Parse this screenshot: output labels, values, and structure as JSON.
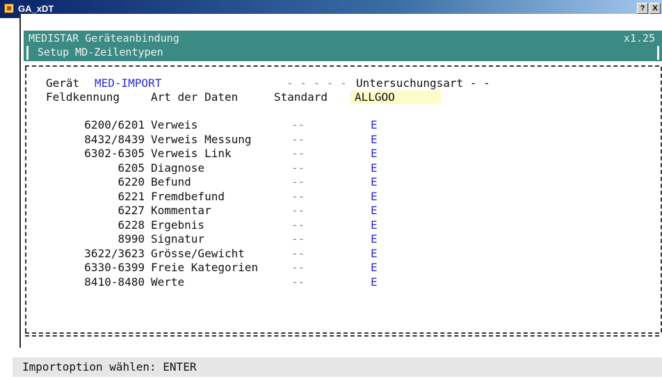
{
  "window": {
    "title": "GA_xDT",
    "help_label": "?",
    "close_label": "X"
  },
  "header": {
    "app_name": "MEDISTAR Geräteanbindung",
    "version": "x1.25",
    "subtitle": "Setup MD-Zeilentypen"
  },
  "form": {
    "geraet_label": "Gerät",
    "geraet_value": "MED-IMPORT",
    "dashes": "- - - - -",
    "untersuchungsart_label": "Untersuchungsart - -",
    "col_feldkennung": "Feldkennung",
    "col_art": "Art der Daten",
    "col_standard": "Standard",
    "col_allgoo": "ALLGOO"
  },
  "rows": [
    {
      "feld": "6200/6201",
      "art": "Verweis",
      "standard": "--",
      "value": "E"
    },
    {
      "feld": "8432/8439",
      "art": "Verweis Messung",
      "standard": "--",
      "value": "E"
    },
    {
      "feld": "6302-6305",
      "art": "Verweis Link",
      "standard": "--",
      "value": "E"
    },
    {
      "feld": "6205",
      "art": "Diagnose",
      "standard": "--",
      "value": "E"
    },
    {
      "feld": "6220",
      "art": "Befund",
      "standard": "--",
      "value": "E"
    },
    {
      "feld": "6221",
      "art": "Fremdbefund",
      "standard": "--",
      "value": "E"
    },
    {
      "feld": "6227",
      "art": "Kommentar",
      "standard": "--",
      "value": "E"
    },
    {
      "feld": "6228",
      "art": "Ergebnis",
      "standard": "--",
      "value": "E"
    },
    {
      "feld": "8990",
      "art": "Signatur",
      "standard": "--",
      "value": "E"
    },
    {
      "feld": "3622/3623",
      "art": "Grösse/Gewicht",
      "standard": "--",
      "value": "E"
    },
    {
      "feld": "6330-6399",
      "art": "Freie Kategorien",
      "standard": "--",
      "value": "E"
    },
    {
      "feld": "8410-8480",
      "art": "Werte",
      "standard": "--",
      "value": "E"
    }
  ],
  "status": {
    "message": "Importoption wählen: ENTER"
  }
}
